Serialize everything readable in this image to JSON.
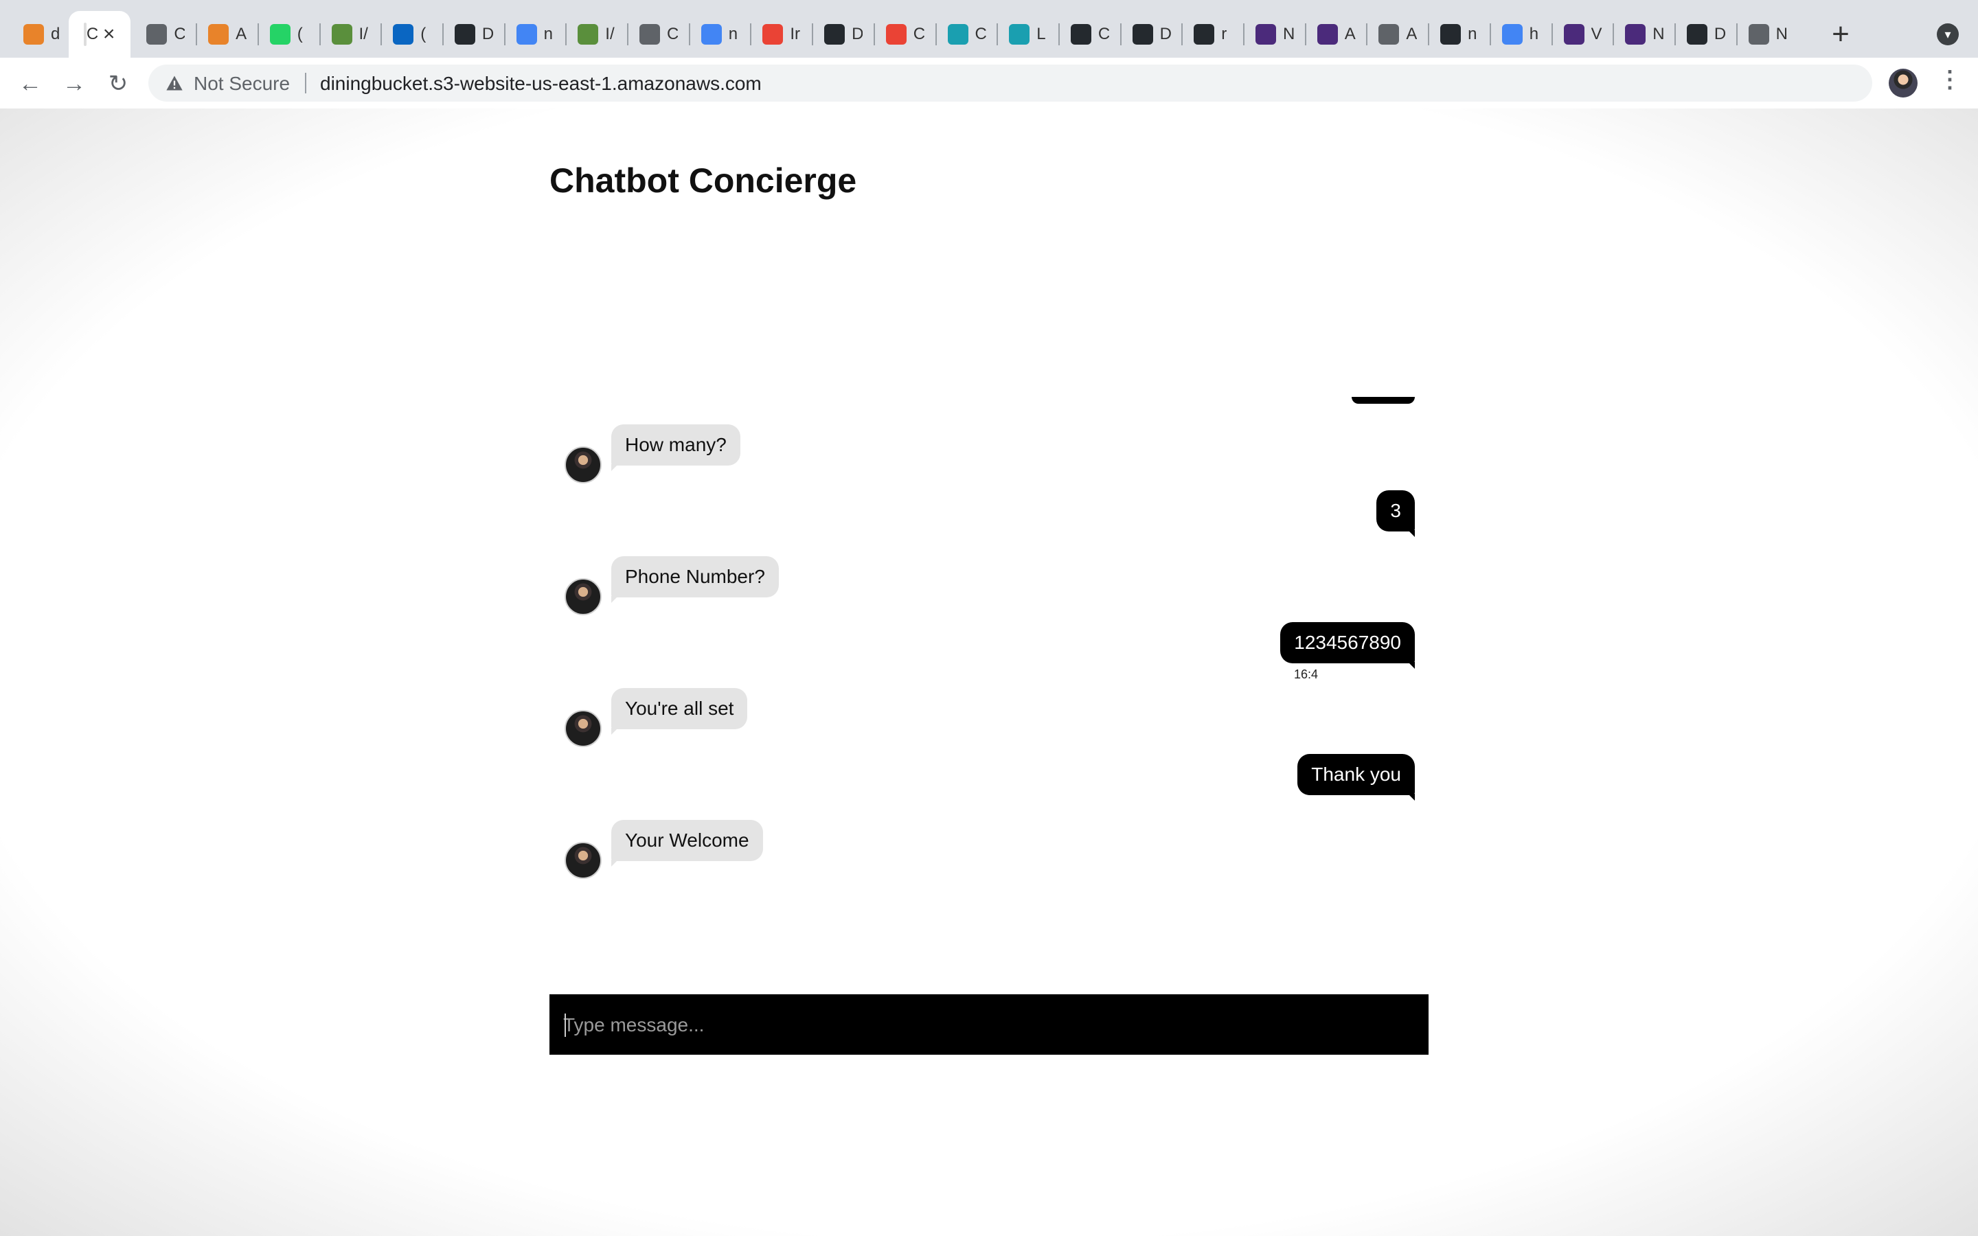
{
  "browser": {
    "tabs": [
      {
        "title": "d",
        "icon": "aws-cube-icon",
        "color": "#e8832a"
      },
      {
        "title": "Cl",
        "icon": "page-icon",
        "color": "#ffffff",
        "active": true
      },
      {
        "title": "C",
        "icon": "globe-icon",
        "color": "#5f6368"
      },
      {
        "title": "A",
        "icon": "aws-cube-icon",
        "color": "#e8832a"
      },
      {
        "title": "(",
        "icon": "whatsapp-icon",
        "color": "#25d366"
      },
      {
        "title": "I/",
        "icon": "key-icon",
        "color": "#5a8f3c"
      },
      {
        "title": "(",
        "icon": "linkedin-icon",
        "color": "#0a66c2"
      },
      {
        "title": "D",
        "icon": "github-icon",
        "color": "#24292e"
      },
      {
        "title": "n",
        "icon": "google-icon",
        "color": "#4285f4"
      },
      {
        "title": "I/",
        "icon": "key-icon",
        "color": "#5a8f3c"
      },
      {
        "title": "C",
        "icon": "globe-icon",
        "color": "#5f6368"
      },
      {
        "title": "n",
        "icon": "google-icon",
        "color": "#4285f4"
      },
      {
        "title": "Ir",
        "icon": "gmail-icon",
        "color": "#ea4335"
      },
      {
        "title": "D",
        "icon": "github-icon",
        "color": "#24292e"
      },
      {
        "title": "C",
        "icon": "gmail-icon",
        "color": "#ea4335"
      },
      {
        "title": "C",
        "icon": "chart-icon",
        "color": "#1a9fb0"
      },
      {
        "title": "L",
        "icon": "chart-icon",
        "color": "#1a9fb0"
      },
      {
        "title": "C",
        "icon": "github-icon",
        "color": "#24292e"
      },
      {
        "title": "D",
        "icon": "github-icon",
        "color": "#24292e"
      },
      {
        "title": "r",
        "icon": "github-icon",
        "color": "#24292e"
      },
      {
        "title": "N",
        "icon": "columbia-icon",
        "color": "#4b2a7b"
      },
      {
        "title": "A",
        "icon": "columbia-icon",
        "color": "#4b2a7b"
      },
      {
        "title": "A",
        "icon": "globe-icon",
        "color": "#5f6368"
      },
      {
        "title": "n",
        "icon": "github-icon",
        "color": "#24292e"
      },
      {
        "title": "h",
        "icon": "google-icon",
        "color": "#4285f4"
      },
      {
        "title": "V",
        "icon": "columbia-icon",
        "color": "#4b2a7b"
      },
      {
        "title": "N",
        "icon": "columbia-icon",
        "color": "#4b2a7b"
      },
      {
        "title": "D",
        "icon": "github-icon",
        "color": "#24292e"
      },
      {
        "title": "N",
        "icon": "chrome-icon",
        "color": "#5f6368"
      }
    ],
    "security_label": "Not Secure",
    "url": "diningbucket.s3-website-us-east-1.amazonaws.com"
  },
  "page": {
    "title": "Chatbot Concierge"
  },
  "chat": {
    "messages": [
      {
        "from": "bot",
        "text": "How many?"
      },
      {
        "from": "user",
        "text": "3"
      },
      {
        "from": "bot",
        "text": "Phone Number?"
      },
      {
        "from": "user",
        "text": "1234567890",
        "time": "16:4"
      },
      {
        "from": "bot",
        "text": "You're all set"
      },
      {
        "from": "user",
        "text": "Thank you"
      },
      {
        "from": "bot",
        "text": "Your Welcome"
      }
    ],
    "input_placeholder": "Type message...",
    "input_value": ""
  }
}
